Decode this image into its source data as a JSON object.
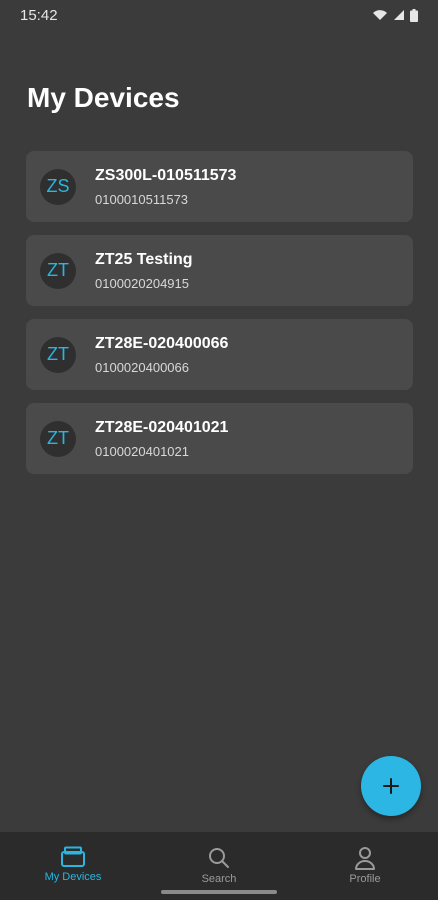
{
  "status_bar": {
    "time": "15:42",
    "icons": [
      "wifi-icon",
      "signal-icon",
      "battery-icon"
    ]
  },
  "page": {
    "title": "My Devices"
  },
  "devices": [
    {
      "initials": "ZS",
      "name": "ZS300L-010511573",
      "serial": "0100010511573"
    },
    {
      "initials": "ZT",
      "name": "ZT25 Testing",
      "serial": "0100020204915"
    },
    {
      "initials": "ZT",
      "name": "ZT28E-020400066",
      "serial": "0100020400066"
    },
    {
      "initials": "ZT",
      "name": "ZT28E-020401021",
      "serial": "0100020401021"
    }
  ],
  "fab": {
    "icon": "plus-icon"
  },
  "bottom_nav": [
    {
      "label": "My Devices",
      "icon": "printer-icon",
      "active": true
    },
    {
      "label": "Search",
      "icon": "search-icon",
      "active": false
    },
    {
      "label": "Profile",
      "icon": "person-icon",
      "active": false
    }
  ],
  "colors": {
    "accent": "#29b6e0",
    "background": "#3b3b3b",
    "card": "#4a4a4a",
    "nav_background": "#2b2b2b"
  }
}
